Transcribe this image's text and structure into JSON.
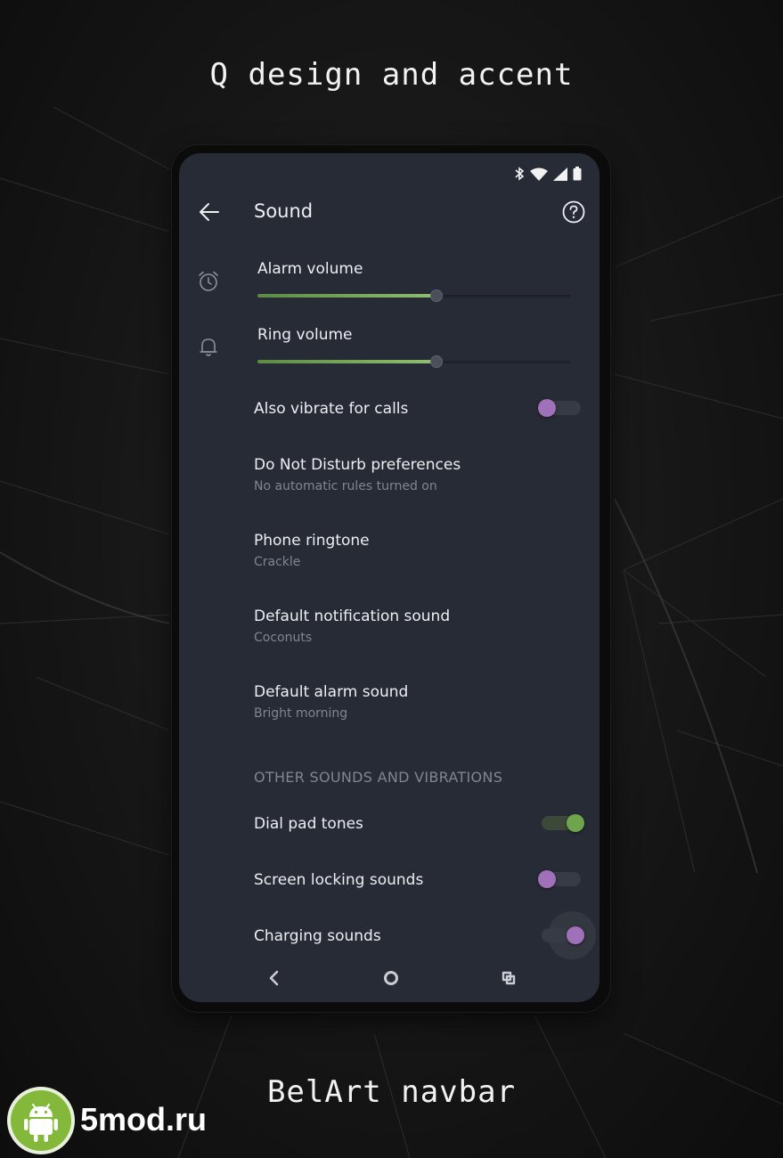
{
  "promo": {
    "headline": "Q design and accent",
    "footline": "BelArt navbar"
  },
  "watermark": {
    "text": "5mod.ru",
    "icon": "android-robot-icon",
    "badge_color": "#83b83a"
  },
  "status_bar": {
    "icons": [
      "bluetooth-icon",
      "wifi-icon",
      "cell-signal-icon",
      "battery-icon"
    ]
  },
  "app_bar": {
    "title": "Sound",
    "back_icon": "arrow-back-icon",
    "help_icon": "help-circle-icon"
  },
  "volumes": [
    {
      "label": "Alarm volume",
      "icon": "alarm-clock-icon",
      "level_percent": 57
    },
    {
      "label": "Ring volume",
      "icon": "bell-icon",
      "level_percent": 57
    }
  ],
  "settings": [
    {
      "label": "Also vibrate for calls",
      "toggle": "off"
    },
    {
      "label": "Do Not Disturb preferences",
      "summary": "No automatic rules turned on"
    },
    {
      "label": "Phone ringtone",
      "summary": "Crackle"
    },
    {
      "label": "Default notification sound",
      "summary": "Coconuts"
    },
    {
      "label": "Default alarm sound",
      "summary": "Bright morning"
    }
  ],
  "other_section": {
    "header": "OTHER SOUNDS AND VIBRATIONS",
    "items": [
      {
        "label": "Dial pad tones",
        "toggle": "on"
      },
      {
        "label": "Screen locking sounds",
        "toggle": "off"
      },
      {
        "label": "Charging sounds",
        "toggle": "on-pressed"
      }
    ]
  },
  "nav_bar": {
    "buttons": [
      "back-icon",
      "home-icon",
      "recents-icon"
    ]
  },
  "colors": {
    "screen_bg": "#272b35",
    "accent_slider": "#8ec070",
    "toggle_on": "#6ea54c",
    "toggle_off_knob": "#a070b8",
    "text_primary": "#eceef2",
    "text_secondary": "#7f8591"
  }
}
